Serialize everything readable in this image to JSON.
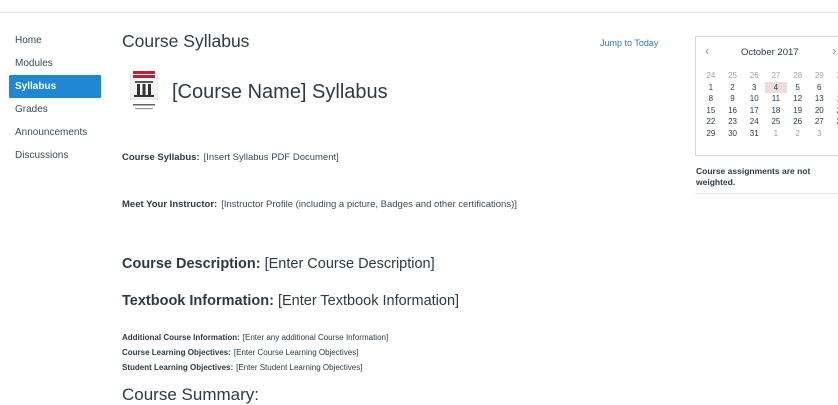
{
  "nav": {
    "items": [
      {
        "label": "Home"
      },
      {
        "label": "Modules"
      },
      {
        "label": "Syllabus"
      },
      {
        "label": "Grades"
      },
      {
        "label": "Announcements"
      },
      {
        "label": "Discussions"
      }
    ],
    "active_index": 2
  },
  "header": {
    "title": "Course Syllabus",
    "jump_link": "Jump to Today"
  },
  "logo": {
    "icon": "college-logo-icon",
    "caption": "SANTA ANA COLLEGE"
  },
  "content": {
    "syllabus_heading": "[Course Name] Syllabus",
    "course_syllabus_label": "Course Syllabus:",
    "course_syllabus_value": "[Insert Syllabus PDF Document]",
    "instructor_label": "Meet Your Instructor:",
    "instructor_value": "[Instructor Profile (including a picture, Badges and other certifications)]",
    "description_label": "Course Description:",
    "description_value": "[Enter Course Description]",
    "textbook_label": "Textbook Information:",
    "textbook_value": "[Enter Textbook Information]",
    "additional_label": "Additional Course Information:",
    "additional_value": "[Enter any additional Course Information]",
    "clo_label": "Course Learning Objectives:",
    "clo_value": "[Enter Course Learning Objectives]",
    "slo_label": "Student Learning Objectives:",
    "slo_value": "[Enter Student Learning Objectives]",
    "summary_heading": "Course Summary:"
  },
  "calendar": {
    "month": "October 2017",
    "prev_icon": "chevron-left-icon",
    "next_icon": "chevron-right-icon",
    "rows": [
      [
        "24",
        "25",
        "26",
        "27",
        "28",
        "29",
        "30"
      ],
      [
        "1",
        "2",
        "3",
        "4",
        "5",
        "6",
        "7"
      ],
      [
        "8",
        "9",
        "10",
        "11",
        "12",
        "13",
        "14"
      ],
      [
        "15",
        "16",
        "17",
        "18",
        "19",
        "20",
        "21"
      ],
      [
        "22",
        "23",
        "24",
        "25",
        "26",
        "27",
        "28"
      ],
      [
        "29",
        "30",
        "31",
        "1",
        "2",
        "3",
        "4"
      ]
    ],
    "muted_first_row": true,
    "muted_last_row_from": 3,
    "today": "4",
    "note": "Course assignments are not weighted."
  },
  "colors": {
    "accent": "#1e88d2",
    "link": "#2a7ac0",
    "today_bg": "#ecdcdc"
  }
}
